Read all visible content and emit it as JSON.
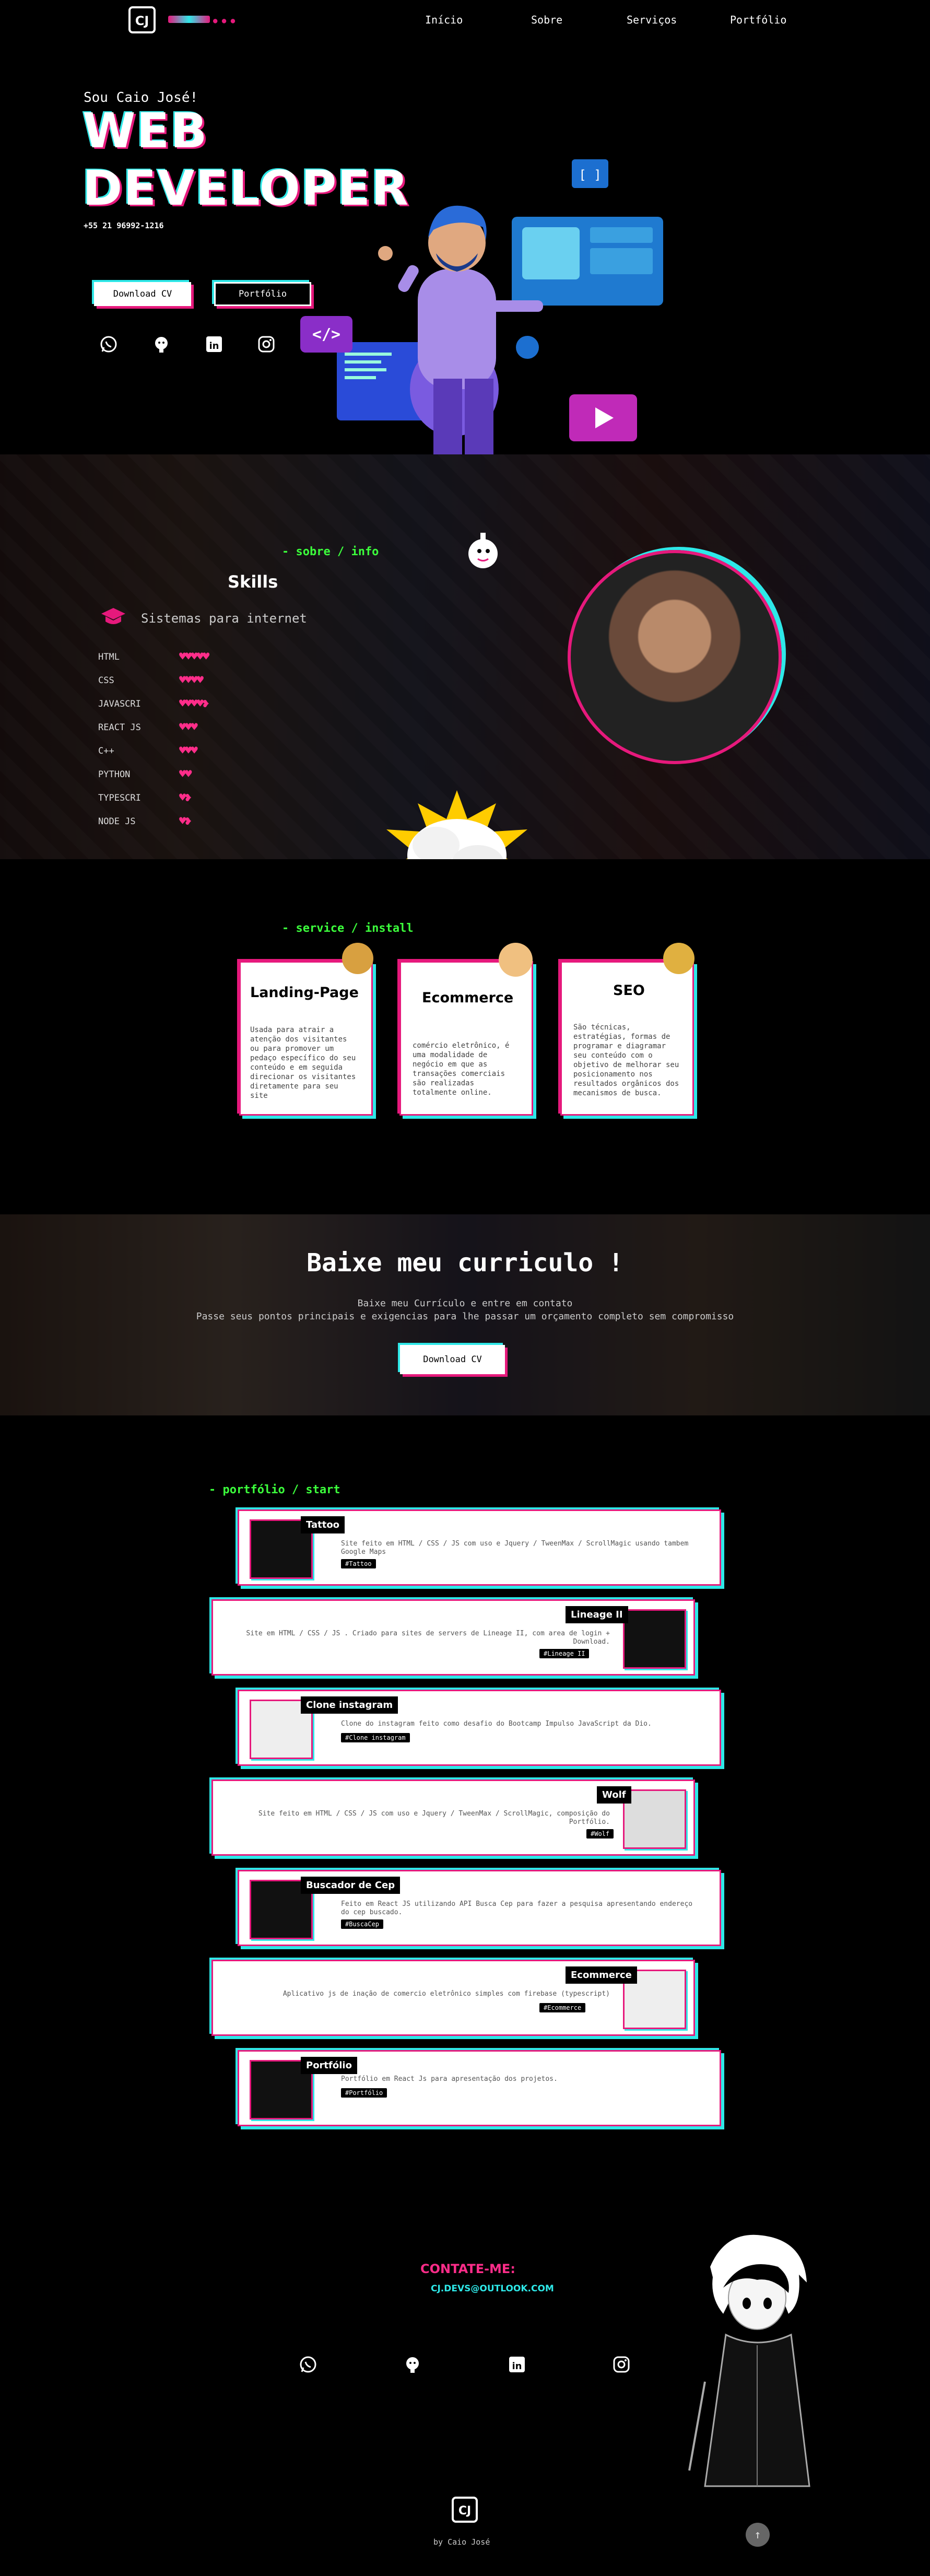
{
  "nav": {
    "logo": "CJ",
    "items": [
      "Início",
      "Sobre",
      "Serviços",
      "Portfólio"
    ]
  },
  "hero": {
    "greeting": "Sou Caio José!",
    "title_line1": "WEB",
    "title_line2": "DEVELOPER",
    "phone": "+55 21 96992-1216",
    "btn_cv": "Download CV",
    "btn_portfolio": "Portfólio",
    "social": [
      "whatsapp-icon",
      "github-icon",
      "linkedin-icon",
      "instagram-icon"
    ]
  },
  "about": {
    "section_label": "- sobre / info",
    "skills_title": "Skills",
    "specialty": "Sistemas para internet",
    "skills": [
      {
        "name": "HTML",
        "level": 5
      },
      {
        "name": "CSS",
        "level": 4
      },
      {
        "name": "JAVASCRI",
        "level": 4.5
      },
      {
        "name": "REACT JS",
        "level": 3
      },
      {
        "name": "C++",
        "level": 3
      },
      {
        "name": "PYTHON",
        "level": 2
      },
      {
        "name": "TYPESCRI",
        "level": 1.5
      },
      {
        "name": "NODE JS",
        "level": 1.5
      }
    ]
  },
  "services": {
    "section_label": "- service / install",
    "cards": [
      {
        "title": "Landing-Page",
        "text": "Usada para atrair a atenção dos visitantes ou para promover um pedaço específico do seu conteúdo e em seguida direcionar os visitantes diretamente para seu site"
      },
      {
        "title": "Ecommerce",
        "text": "comércio eletrônico, é uma modalidade de negócio em que as transações comerciais são realizadas totalmente online."
      },
      {
        "title": "SEO",
        "text": "São técnicas, estratégias, formas de programar e diagramar seu conteúdo com o objetivo de melhorar seu posicionamento nos resultados orgânicos dos mecanismos de busca."
      }
    ]
  },
  "resume": {
    "title": "Baixe meu curriculo !",
    "line1": "Baixe meu Currículo e entre em contato",
    "line2": "Passe seus pontos principais e exigencias para lhe passar um orçamento completo sem compromisso",
    "button": "Download CV"
  },
  "portfolio": {
    "section_label": "- portfólio / start",
    "projects": [
      {
        "title": "Tattoo",
        "desc": "Site feito em HTML / CSS / JS com uso e Jquery / TweenMax / ScrollMagic usando tambem Google Maps",
        "tag": "#Tattoo"
      },
      {
        "title": "Lineage II",
        "desc": "Site em HTML / CSS / JS . Criado para sites de servers de Lineage II, com area de login + Download.",
        "tag": "#Lineage II"
      },
      {
        "title": "Clone instagram",
        "desc": "Clone do instagram feito como desafio do Bootcamp Impulso JavaScript da Dio.",
        "tag": "#Clone instagram"
      },
      {
        "title": "Wolf",
        "desc": "Site feito em HTML / CSS / JS com uso e Jquery / TweenMax / ScrollMagic, composição do Portfólio.",
        "tag": "#Wolf"
      },
      {
        "title": "Buscador de Cep",
        "desc": "Feito em React JS utilizando API Busca Cep para fazer a pesquisa apresentando endereço do cep buscado.",
        "tag": "#BuscaCep"
      },
      {
        "title": "Ecommerce",
        "desc": "Aplicativo js de inação de comercio eletrônico simples com firebase (typescript)",
        "tag": "#Ecommerce"
      },
      {
        "title": "Portfólio",
        "desc": "Portfólio em React Js para apresentação dos projetos.",
        "tag": "#Portfólio"
      }
    ]
  },
  "contact": {
    "title": "CONTATE-ME:",
    "email": "CJ.DEVS@OUTLOOK.COM",
    "social": [
      "whatsapp-icon",
      "github-icon",
      "linkedin-icon",
      "instagram-icon"
    ]
  },
  "footer": {
    "logo": "CJ",
    "credit": "by Caio José"
  },
  "colors": {
    "accent_pink": "#e6197c",
    "accent_cyan": "#2ee8e8",
    "accent_green": "#3cff3c"
  }
}
